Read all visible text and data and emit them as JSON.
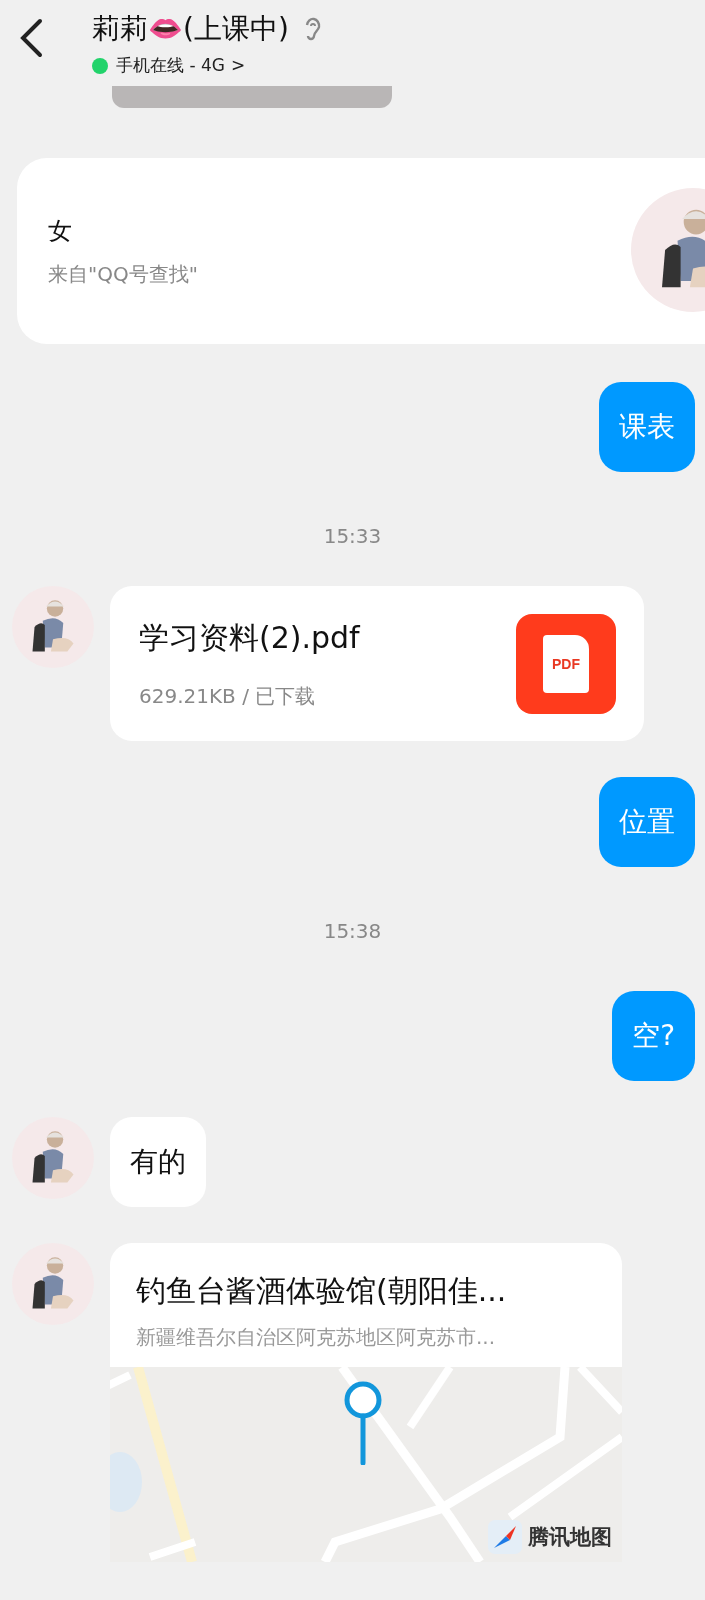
{
  "header": {
    "title": "莉莉👄(上课中)",
    "status": "手机在线 - 4G",
    "status_arrow": ">",
    "online": true
  },
  "messages": [
    {
      "kind": "profile",
      "title": "女",
      "subtitle": "来自\"QQ号查找\""
    },
    {
      "kind": "text",
      "outgoing": true,
      "text": "课表"
    },
    {
      "kind": "time",
      "text": "15:33"
    },
    {
      "kind": "file",
      "outgoing": false,
      "name": "学习资料(2).pdf",
      "meta": "629.21KB / 已下载",
      "file_type": "PDF"
    },
    {
      "kind": "text",
      "outgoing": true,
      "text": "位置"
    },
    {
      "kind": "time",
      "text": "15:38"
    },
    {
      "kind": "text",
      "outgoing": true,
      "text": "空?"
    },
    {
      "kind": "text",
      "outgoing": false,
      "text": "有的"
    },
    {
      "kind": "location",
      "outgoing": false,
      "name": "钓鱼台酱酒体验馆(朝阳佳...",
      "address": "新疆维吾尔自治区阿克苏地区阿克苏市...",
      "map_logo": "腾讯地图"
    }
  ]
}
